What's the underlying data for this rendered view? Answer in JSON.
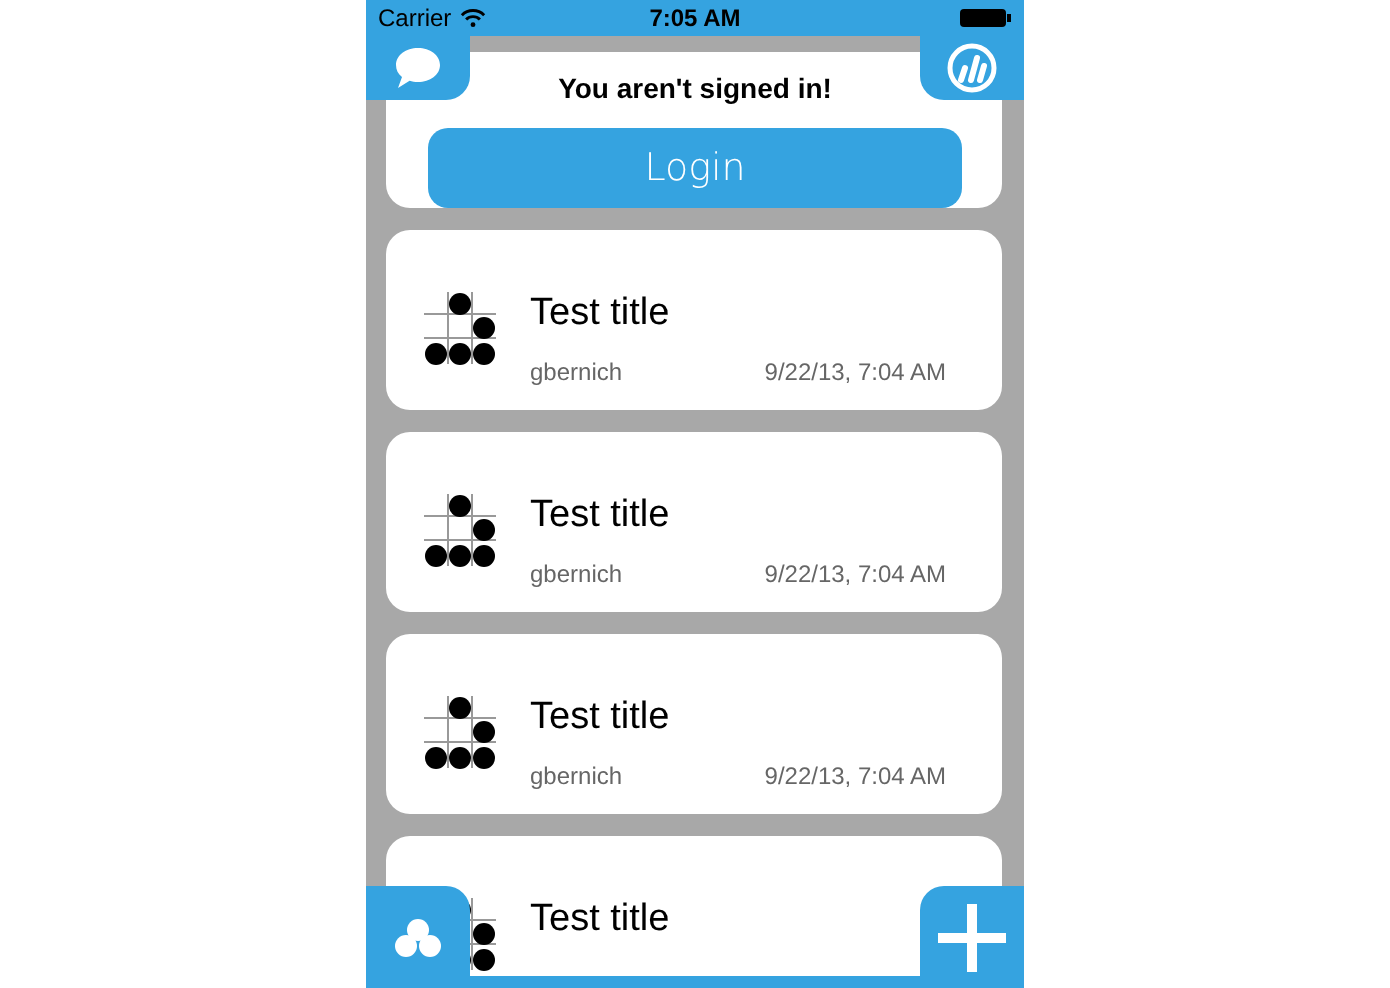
{
  "status_bar": {
    "carrier": "Carrier",
    "time": "7:05 AM"
  },
  "sign_in": {
    "message": "You aren't signed in!",
    "button": "Login"
  },
  "posts": [
    {
      "title": "Test title",
      "author": "gbernich",
      "date": "9/22/13, 7:04 AM"
    },
    {
      "title": "Test title",
      "author": "gbernich",
      "date": "9/22/13, 7:04 AM"
    },
    {
      "title": "Test title",
      "author": "gbernich",
      "date": "9/22/13, 7:04 AM"
    },
    {
      "title": "Test title"
    }
  ]
}
